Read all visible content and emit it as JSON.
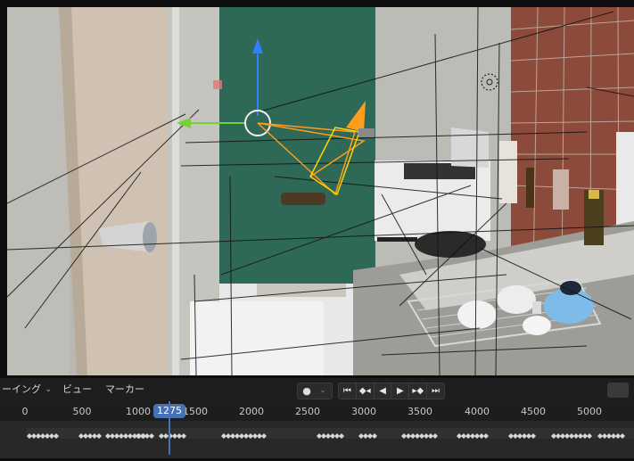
{
  "timeline": {
    "mode_dropdown": "ーイング",
    "menus": [
      "ビュー",
      "マーカー"
    ],
    "record_icon": "record-dot-icon",
    "transport_icons": [
      "jump-to-start-icon",
      "prev-keyframe-icon",
      "play-reverse-icon",
      "play-icon",
      "next-keyframe-icon",
      "jump-to-end-icon"
    ],
    "transport_glyphs": [
      "⏮",
      "◆◂",
      "◀",
      "▶",
      "▸◆",
      "⏭"
    ],
    "current_frame": "1275",
    "ruler_ticks": [
      "0",
      "500",
      "1000",
      "1500",
      "2000",
      "2500",
      "3000",
      "3500",
      "4000",
      "4500",
      "5000"
    ]
  },
  "colors": {
    "accent": "#4772b3",
    "gizmo_blue": "#2f7fff",
    "gizmo_green": "#74d136",
    "camera_orange": "#ff9c1c",
    "camera_yellow": "#ffd400"
  }
}
